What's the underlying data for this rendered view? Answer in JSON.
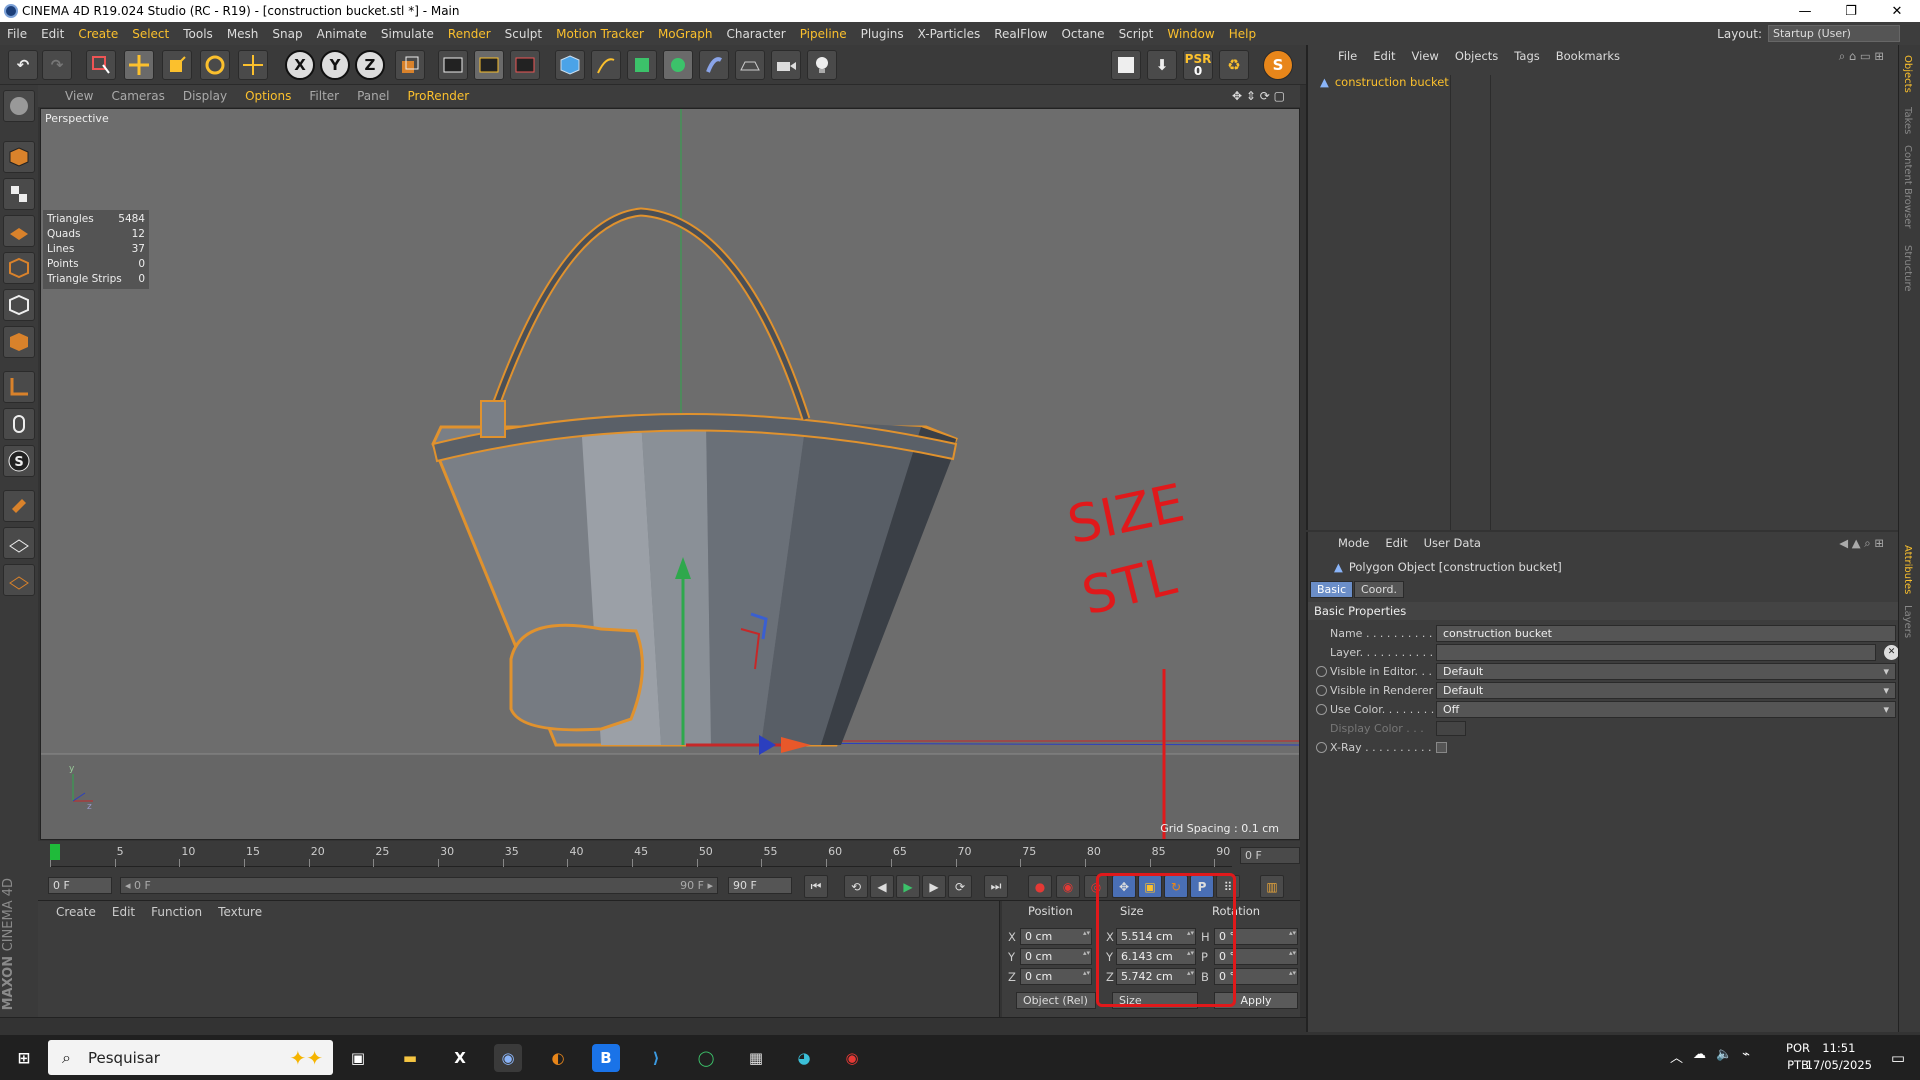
{
  "window": {
    "title": "CINEMA 4D R19.024 Studio (RC - R19) - [construction bucket.stl *] - Main",
    "minimize": "—",
    "restore": "❐",
    "close": "✕"
  },
  "menubar": {
    "items": [
      "File",
      "Edit",
      "Create",
      "Select",
      "Tools",
      "Mesh",
      "Snap",
      "Animate",
      "Simulate",
      "Render",
      "Sculpt",
      "Motion Tracker",
      "MoGraph",
      "Character",
      "Pipeline",
      "Plugins",
      "X-Particles",
      "RealFlow",
      "Octane",
      "Script",
      "Window",
      "Help"
    ],
    "highlighted": [
      "Create",
      "Select",
      "Render",
      "Motion Tracker",
      "MoGraph",
      "Pipeline",
      "Window",
      "Help"
    ],
    "layout_label": "Layout:",
    "layout_value": "Startup (User)"
  },
  "toolbar": {
    "axis_x": "X",
    "axis_y": "Y",
    "axis_z": "Z",
    "psr_label": "PSR",
    "psr_value": "0"
  },
  "viewport": {
    "menu": [
      "View",
      "Cameras",
      "Display",
      "Options",
      "Filter",
      "Panel",
      "ProRender"
    ],
    "menu_highlighted": [
      "Options",
      "ProRender"
    ],
    "camera": "Perspective",
    "stats": [
      {
        "label": "Triangles",
        "value": "5484"
      },
      {
        "label": "Quads",
        "value": "12"
      },
      {
        "label": "Lines",
        "value": "37"
      },
      {
        "label": "Points",
        "value": "0"
      },
      {
        "label": "Triangle Strips",
        "value": "0"
      }
    ],
    "grid_spacing": "Grid Spacing : 0.1 cm",
    "annotation_line1": "SIZE",
    "annotation_line2": "STL",
    "annotation_color": "#e0191b",
    "axis_y_label": "y",
    "axis_z_label": "z"
  },
  "timeline": {
    "ticks": [
      "0",
      "5",
      "10",
      "15",
      "20",
      "25",
      "30",
      "35",
      "40",
      "45",
      "50",
      "55",
      "60",
      "65",
      "70",
      "75",
      "80",
      "85",
      "90"
    ],
    "current_frame": "0 F",
    "start_field": "0 F",
    "range_start": "◂ 0 F",
    "range_end": "90 F ▸",
    "end_field": "90 F"
  },
  "material_manager": {
    "menu": [
      "Create",
      "Edit",
      "Function",
      "Texture"
    ]
  },
  "coord_manager": {
    "headers": {
      "position": "Position",
      "size": "Size",
      "rotation": "Rotation"
    },
    "rows": [
      {
        "axis": "X",
        "pos": "0 cm",
        "size": "5.514 cm",
        "rot_axis": "H",
        "rot": "0 °"
      },
      {
        "axis": "Y",
        "pos": "0 cm",
        "size": "6.143 cm",
        "rot_axis": "P",
        "rot": "0 °"
      },
      {
        "axis": "Z",
        "pos": "0 cm",
        "size": "5.742 cm",
        "rot_axis": "B",
        "rot": "0 °"
      }
    ],
    "mode": "Object (Rel)",
    "size_mode": "Size",
    "apply": "Apply"
  },
  "object_manager": {
    "menu": [
      "File",
      "Edit",
      "View",
      "Objects",
      "Tags",
      "Bookmarks"
    ],
    "object_name": "construction bucket"
  },
  "attribute_manager": {
    "menu": [
      "Mode",
      "Edit",
      "User Data"
    ],
    "title": "Polygon Object [construction bucket]",
    "tabs": [
      "Basic",
      "Coord."
    ],
    "section": "Basic Properties",
    "rows": [
      {
        "label": "Name . . . . . . . . . . . .",
        "value": "construction bucket"
      },
      {
        "label": "Layer. . . . . . . . . . . .",
        "value": ""
      },
      {
        "label": "Visible in Editor. . .",
        "value": "Default"
      },
      {
        "label": "Visible in Renderer",
        "value": "Default"
      },
      {
        "label": "Use Color. . . . . . . .",
        "value": "Off"
      },
      {
        "label": "Display Color . . .",
        "value": ""
      },
      {
        "label": "X-Ray . . . . . . . . . . .",
        "value": ""
      }
    ]
  },
  "side_tabs": [
    "Objects",
    "Takes",
    "Content Browser",
    "Structure",
    "Attributes",
    "Layers"
  ],
  "logo": {
    "maxon": "MAXON",
    "c4d": "CINEMA 4D"
  },
  "taskbar": {
    "search_placeholder": "Pesquisar",
    "lang1": "POR",
    "lang2": "PTB",
    "time": "11:51",
    "date": "17/05/2025"
  }
}
